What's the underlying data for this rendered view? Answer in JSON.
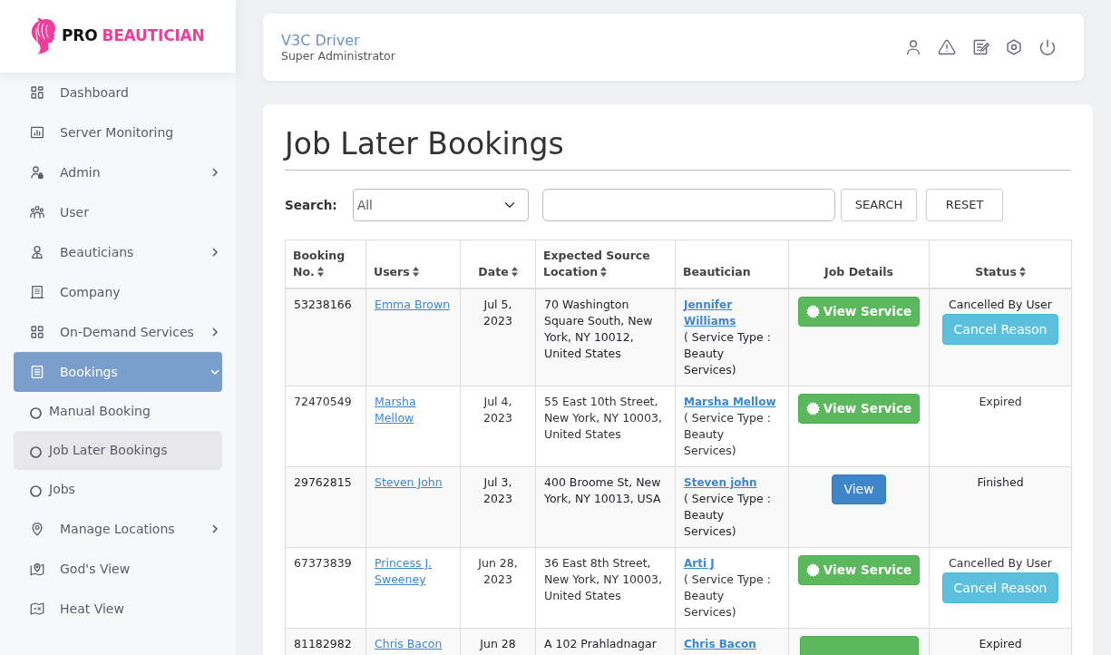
{
  "logo": {
    "prefix": "PRO",
    "name": "BEAUTICIAN"
  },
  "sidebar": {
    "items": [
      {
        "label": "Dashboard",
        "kind": "link",
        "selected": false
      },
      {
        "label": "Server Monitoring",
        "kind": "link",
        "selected": false
      },
      {
        "label": "Admin",
        "kind": "group",
        "selected": false,
        "expanded": false
      },
      {
        "label": "User",
        "kind": "link",
        "selected": false
      },
      {
        "label": "Beauticians",
        "kind": "group",
        "selected": false,
        "expanded": false
      },
      {
        "label": "Company",
        "kind": "link",
        "selected": false
      },
      {
        "label": "On-Demand Services",
        "kind": "group",
        "selected": false,
        "expanded": false
      },
      {
        "label": "Bookings",
        "kind": "group",
        "selected": true,
        "expanded": true,
        "children": [
          {
            "label": "Manual Booking",
            "selected": false
          },
          {
            "label": "Job Later Bookings",
            "selected": true
          },
          {
            "label": "Jobs",
            "selected": false
          }
        ]
      },
      {
        "label": "Manage Locations",
        "kind": "group",
        "selected": false,
        "expanded": false
      },
      {
        "label": "God's View",
        "kind": "link",
        "selected": false
      },
      {
        "label": "Heat View",
        "kind": "link",
        "selected": false
      }
    ]
  },
  "header": {
    "user_name": "V3C Driver",
    "role": "Super Administrator"
  },
  "page": {
    "title": "Job Later Bookings"
  },
  "search": {
    "label": "Search:",
    "filter": "All",
    "buttons": [
      "SEARCH",
      "RESET"
    ]
  },
  "table": {
    "columns": [
      {
        "label": "Booking No.",
        "sortable": true
      },
      {
        "label": "Users",
        "sortable": true
      },
      {
        "label": "Date",
        "sortable": true
      },
      {
        "label": "Expected Source Location",
        "sortable": true
      },
      {
        "label": "Beautician",
        "sortable": false
      },
      {
        "label": "Job Details",
        "sortable": false
      },
      {
        "label": "Status",
        "sortable": true
      }
    ],
    "rows": [
      {
        "booking_no": "53238166",
        "user": "Emma Brown",
        "date": "Jul 5, 2023",
        "location": "70 Washington Square South, New York, NY 10012, United States",
        "beautician": "Jennifer Williams",
        "service_type": "( Service Type : Beauty Services)",
        "job_details": {
          "kind": "service",
          "label": "View Service"
        },
        "status": "Cancelled By User",
        "status_action": "Cancel Reason"
      },
      {
        "booking_no": "72470549",
        "user": "Marsha Mellow",
        "date": "Jul 4, 2023",
        "location": "55 East 10th Street, New York, NY 10003, United States",
        "beautician": "Marsha Mellow",
        "service_type": "( Service Type : Beauty Services)",
        "job_details": {
          "kind": "service",
          "label": "View Service"
        },
        "status": "Expired"
      },
      {
        "booking_no": "29762815",
        "user": "Steven John",
        "date": "Jul 3, 2023",
        "location": "400 Broome St, New York, NY 10013, USA",
        "beautician": "Steven john",
        "service_type": "( Service Type : Beauty Services)",
        "job_details": {
          "kind": "view",
          "label": "View"
        },
        "status": "Finished"
      },
      {
        "booking_no": "67373839",
        "user": "Princess J. Sweeney",
        "date": "Jun 28, 2023",
        "location": "36 East 8th Street, New York, NY 10003, United States",
        "beautician": "Arti J",
        "service_type": "( Service Type : Beauty Services)",
        "job_details": {
          "kind": "service",
          "label": "View Service"
        },
        "status": "Cancelled By User",
        "status_action": "Cancel Reason"
      },
      {
        "booking_no": "81182982",
        "user": "Chris Bacon",
        "date": "Jun 28",
        "location": "A 102 Prahladnagar",
        "beautician": "Chris Bacon",
        "job_details": {
          "kind": "service"
        },
        "status": "Expired"
      }
    ]
  }
}
